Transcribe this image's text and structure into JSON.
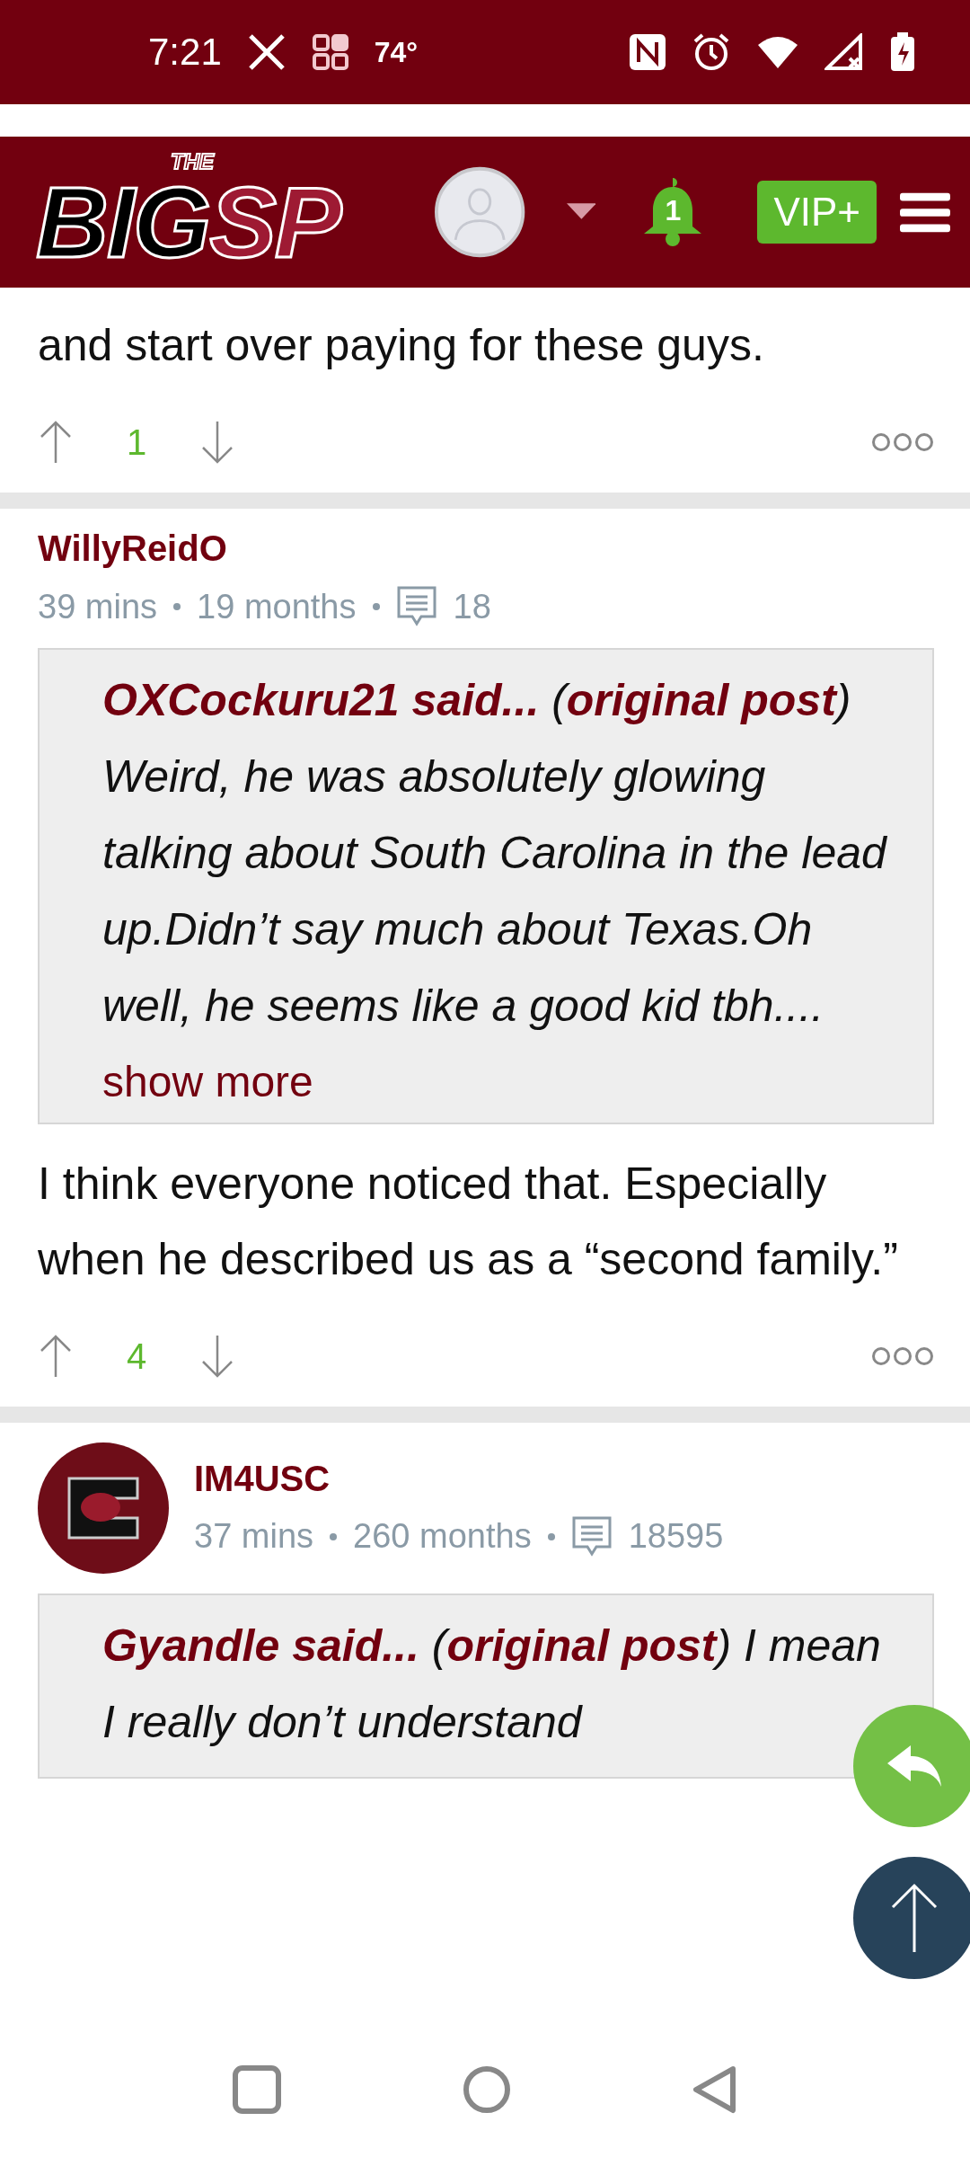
{
  "status_bar": {
    "time": "7:21",
    "temperature": "74°"
  },
  "header": {
    "logo": {
      "top": "THE",
      "left": "BIG",
      "right": "SP"
    },
    "notification_count": "1",
    "vip_label": "VIP+"
  },
  "posts": [
    {
      "kind": "tail",
      "body": "and start over paying for these guys.",
      "score": "1"
    },
    {
      "kind": "full",
      "username": "WillyReidO",
      "has_avatar": false,
      "time": "39 mins",
      "tenure": "19 months",
      "post_count": "18",
      "quote": {
        "text": "**OXCockuru21 said...** (**original post**) Weird, he was absolutely glowing talking about South Carolina in the lead up.Didn’t say much about Texas.Oh well, he seems like a good kid tbh....",
        "show_more": "show more"
      },
      "body": "I think everyone noticed that. Especially when he described us as a “second family.”",
      "score": "4"
    },
    {
      "kind": "full",
      "username": "IM4USC",
      "has_avatar": true,
      "time": "37 mins",
      "tenure": "260 months",
      "post_count": "18595",
      "quote": {
        "text": "**Gyandle said...** (**original post**) I mean I really don’t understand"
      }
    }
  ]
}
